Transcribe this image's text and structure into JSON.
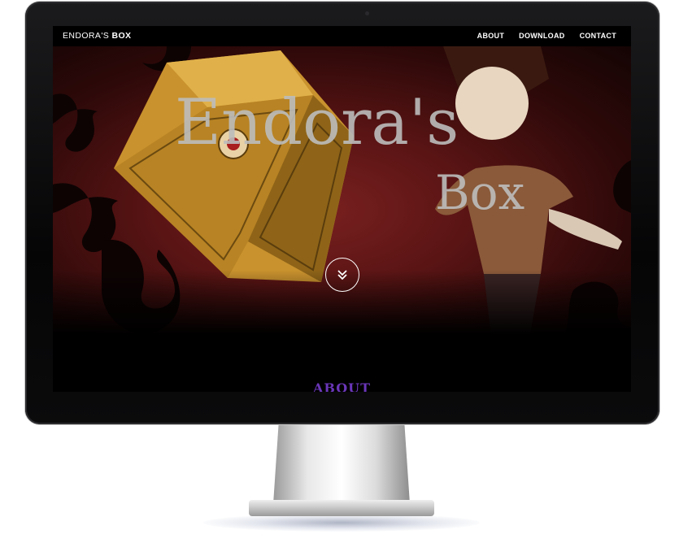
{
  "site": {
    "brand_prefix": "ENDORA'S",
    "brand_bold": "BOX"
  },
  "nav": {
    "items": [
      {
        "label": "ABOUT"
      },
      {
        "label": "DOWNLOAD"
      },
      {
        "label": "CONTACT"
      }
    ]
  },
  "hero": {
    "title_line1": "Endora's",
    "title_line2": "Box",
    "scroll_icon": "chevrons-down-icon"
  },
  "about": {
    "heading": "ABOUT"
  },
  "colors": {
    "background": "#000000",
    "accent_purple": "#6a36b8",
    "hero_red": "#7a2020"
  }
}
